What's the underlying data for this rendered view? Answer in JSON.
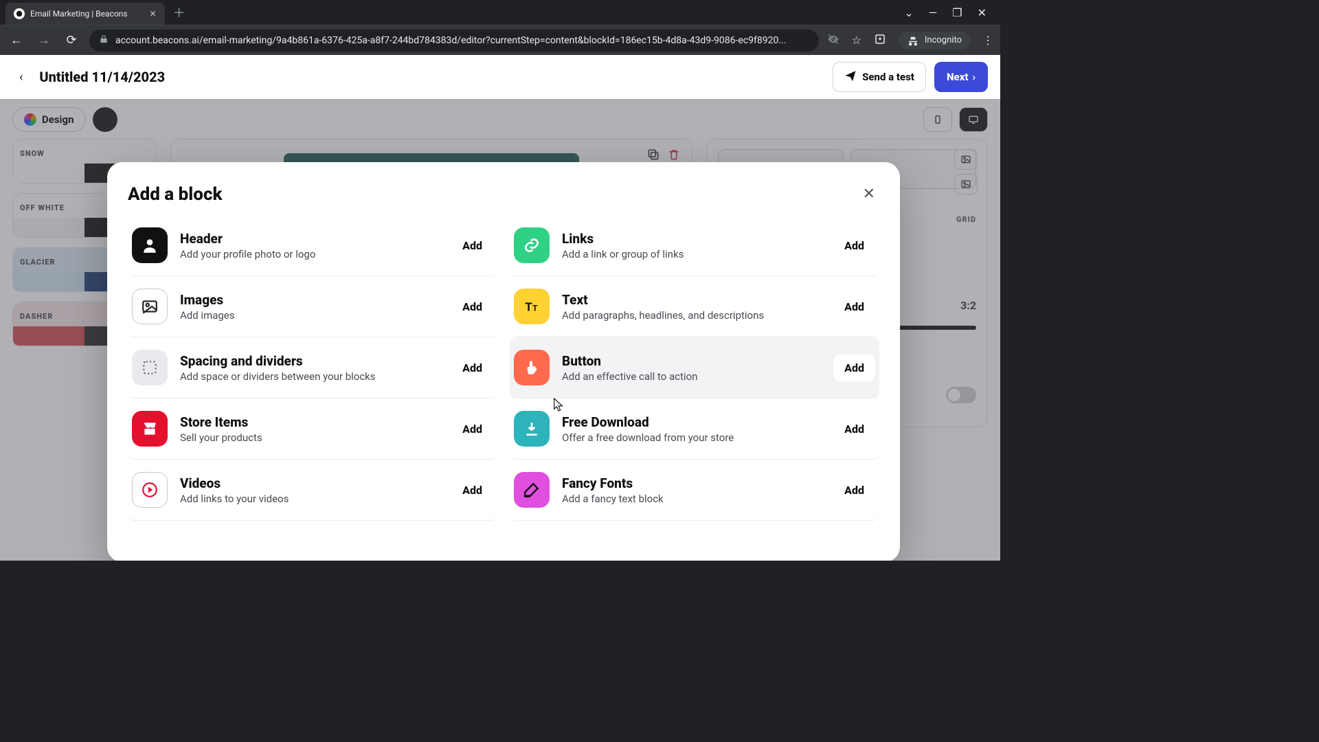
{
  "browser": {
    "tab_title": "Email Marketing | Beacons",
    "url": "account.beacons.ai/email-marketing/9a4b861a-6376-425a-a8f7-244bd784383d/editor?currentStep=content&blockId=186ec15b-4d8a-43d9-9086-ec9f8920...",
    "incognito_label": "Incognito"
  },
  "header": {
    "title": "Untitled 11/14/2023",
    "send_test": "Send a test",
    "next": "Next"
  },
  "toolbar": {
    "design": "Design"
  },
  "themes": [
    {
      "name": "SNOW",
      "colors": [
        "#ffffff",
        "#ffffff",
        "#111111",
        "#d0d0d4"
      ]
    },
    {
      "name": "OFF WHITE",
      "colors": [
        "#f4f4f2",
        "#f4f4f2",
        "#111111",
        "#f4f4f2"
      ]
    },
    {
      "name": "GLACIER",
      "colors": [
        "#cfe4ee",
        "#cfe4ee",
        "#1f3d74",
        "#cfe4ee"
      ]
    },
    {
      "name": "DASHER",
      "colors": [
        "#d64d4d",
        "#d64d4d",
        "#2b2b2b",
        "#efdada"
      ]
    }
  ],
  "right_panel": {
    "ratio": "3:2",
    "grid": "GRID"
  },
  "modal": {
    "title": "Add a block",
    "add_label": "Add",
    "blocks": [
      {
        "title": "Header",
        "desc": "Add your profile photo or logo"
      },
      {
        "title": "Links",
        "desc": "Add a link or group of links"
      },
      {
        "title": "Images",
        "desc": "Add images"
      },
      {
        "title": "Text",
        "desc": "Add paragraphs, headlines, and descriptions"
      },
      {
        "title": "Spacing and dividers",
        "desc": "Add space or dividers between your blocks"
      },
      {
        "title": "Button",
        "desc": "Add an effective call to action"
      },
      {
        "title": "Store Items",
        "desc": "Sell your products"
      },
      {
        "title": "Free Download",
        "desc": "Offer a free download from your store"
      },
      {
        "title": "Videos",
        "desc": "Add links to your videos"
      },
      {
        "title": "Fancy Fonts",
        "desc": "Add a fancy text block"
      }
    ]
  }
}
